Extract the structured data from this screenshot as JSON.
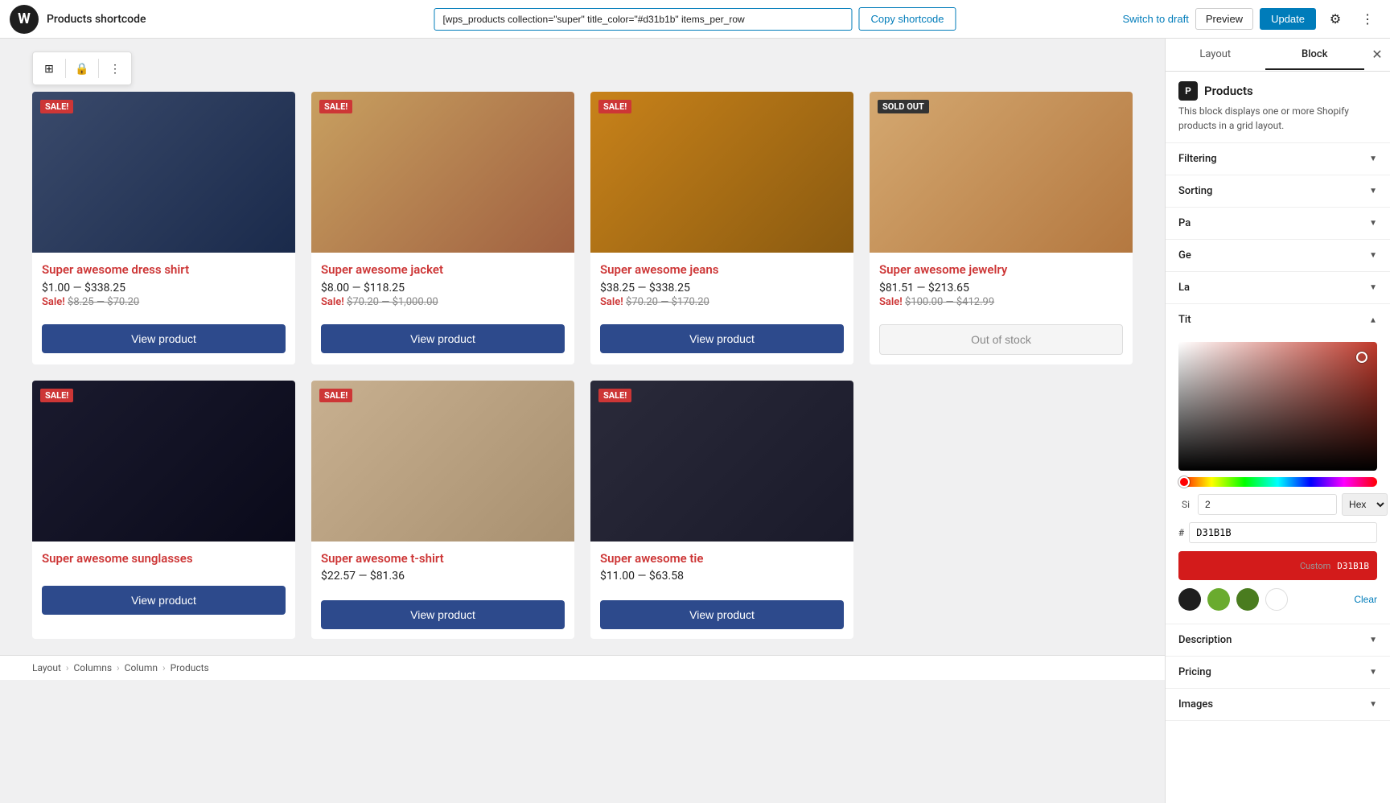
{
  "topbar": {
    "title": "Products shortcode",
    "shortcode_value": "[wps_products collection=\"super\" title_color=\"#d31b1b\" items_per_row",
    "copy_btn_label": "Copy shortcode",
    "switch_draft_label": "Switch to draft",
    "preview_label": "Preview",
    "update_label": "Update"
  },
  "toolbar": {
    "block_icon": "⊞",
    "lock_icon": "🔒",
    "more_icon": "⋮"
  },
  "products": [
    {
      "id": 1,
      "badge": "SALE!",
      "badge_type": "sale",
      "title": "Super awesome dress shirt",
      "price_range": "$1.00 — $338.25",
      "sale_label": "Sale!",
      "sale_price": "$8.25 — $70.20",
      "img_class": "img-dress-shirt",
      "btn_label": "View product",
      "btn_type": "normal"
    },
    {
      "id": 2,
      "badge": "SALE!",
      "badge_type": "sale",
      "title": "Super awesome jacket",
      "price_range": "$8.00 — $118.25",
      "sale_label": "Sale!",
      "sale_price": "$70.20 — $1,000.00",
      "img_class": "img-jacket",
      "btn_label": "View product",
      "btn_type": "normal"
    },
    {
      "id": 3,
      "badge": "SALE!",
      "badge_type": "sale",
      "title": "Super awesome jeans",
      "price_range": "$38.25 — $338.25",
      "sale_label": "Sale!",
      "sale_price": "$70.20 — $170.20",
      "img_class": "img-jeans",
      "btn_label": "View product",
      "btn_type": "normal"
    },
    {
      "id": 4,
      "badge": "SOLD OUT",
      "badge_type": "sold-out",
      "title": "Super awesome jewelry",
      "price_range": "$81.51 — $213.65",
      "sale_label": "Sale!",
      "sale_price": "$100.00 — $412.99",
      "img_class": "img-jewelry",
      "btn_label": "Out of stock",
      "btn_type": "out-of-stock"
    },
    {
      "id": 5,
      "badge": "SALE!",
      "badge_type": "sale",
      "title": "Super awesome sunglasses",
      "price_range": "",
      "sale_label": "",
      "sale_price": "",
      "img_class": "img-sunglasses",
      "btn_label": "View product",
      "btn_type": "normal"
    },
    {
      "id": 6,
      "badge": "SALE!",
      "badge_type": "sale",
      "title": "Super awesome t-shirt",
      "price_range": "$22.57 — $81.36",
      "sale_label": "",
      "sale_price": "",
      "img_class": "img-tshirt",
      "btn_label": "View product",
      "btn_type": "normal"
    },
    {
      "id": 7,
      "badge": "SALE!",
      "badge_type": "sale",
      "title": "Super awesome tie",
      "price_range": "$11.00 — $63.58",
      "sale_label": "",
      "sale_price": "",
      "img_class": "img-tie",
      "btn_label": "View product",
      "btn_type": "normal"
    }
  ],
  "breadcrumb": {
    "items": [
      "Layout",
      "Columns",
      "Column",
      "Products"
    ]
  },
  "sidebar": {
    "tabs": [
      "Layout",
      "Block"
    ],
    "active_tab": "Block",
    "close_icon": "✕",
    "block_title": "Products",
    "block_desc": "This block displays one or more Shopify products in a grid layout.",
    "sections": [
      {
        "label": "Filtering",
        "open": false
      },
      {
        "label": "Sorting",
        "open": false
      },
      {
        "label": "Pa",
        "open": false,
        "partial": true
      },
      {
        "label": "Ge",
        "open": false,
        "partial": true
      },
      {
        "label": "La",
        "open": false,
        "partial": true
      }
    ],
    "title_section_label": "Tit",
    "color_picker": {
      "hex_label": "#",
      "hex_value": "D31B1B",
      "format_label": "Hex",
      "preview_color": "#D31B1B",
      "preview_label": "D31B1B",
      "custom_label": "Custom",
      "custom_value": "D31B1B",
      "swatches": [
        {
          "name": "black",
          "color": "#1e1e1e"
        },
        {
          "name": "green1",
          "color": "#6aab2e"
        },
        {
          "name": "green2",
          "color": "#4a7c1f"
        },
        {
          "name": "white",
          "color": "#ffffff"
        }
      ],
      "clear_label": "Clear"
    },
    "bottom_sections": [
      {
        "label": "Description",
        "open": false
      },
      {
        "label": "Pricing",
        "open": false
      },
      {
        "label": "Images",
        "open": false
      }
    ]
  }
}
